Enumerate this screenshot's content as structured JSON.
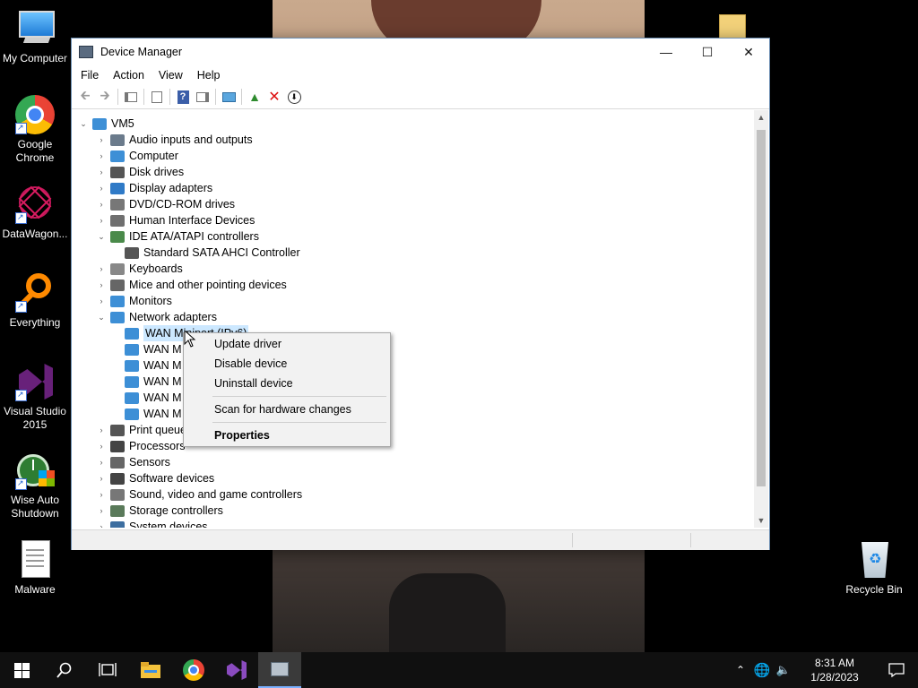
{
  "desktop": {
    "icons": [
      {
        "label": "My Computer",
        "icon": "monitor-icon"
      },
      {
        "label": "Google Chrome",
        "icon": "chrome-icon"
      },
      {
        "label": "DataWagon...",
        "icon": "datawagon-icon"
      },
      {
        "label": "Everything",
        "icon": "everything-search-icon"
      },
      {
        "label": "Visual Studio 2015",
        "icon": "visual-studio-icon"
      },
      {
        "label": "Wise Auto Shutdown",
        "icon": "wise-shutdown-icon"
      },
      {
        "label": "Malware",
        "icon": "text-file-icon"
      },
      {
        "label": "Recycle Bin",
        "icon": "recycle-bin-icon"
      }
    ]
  },
  "window": {
    "title": "Device Manager",
    "controls": {
      "minimize": "—",
      "maximize": "☐",
      "close": "✕"
    },
    "menu": [
      "File",
      "Action",
      "View",
      "Help"
    ],
    "toolbar_icons": [
      "back-arrow-icon",
      "forward-arrow-icon",
      "show-hide-tree-icon",
      "properties-icon",
      "help-icon",
      "action-pane-icon",
      "monitor-scan-icon",
      "update-driver-icon",
      "uninstall-device-icon",
      "disable-device-icon"
    ],
    "tree": {
      "root": "VM5",
      "items": [
        {
          "label": "Audio inputs and outputs",
          "expanded": false
        },
        {
          "label": "Computer",
          "expanded": false
        },
        {
          "label": "Disk drives",
          "expanded": false
        },
        {
          "label": "Display adapters",
          "expanded": false
        },
        {
          "label": "DVD/CD-ROM drives",
          "expanded": false
        },
        {
          "label": "Human Interface Devices",
          "expanded": false
        },
        {
          "label": "IDE ATA/ATAPI controllers",
          "expanded": true
        },
        {
          "label": "Standard SATA AHCI Controller",
          "child": true
        },
        {
          "label": "Keyboards",
          "expanded": false
        },
        {
          "label": "Mice and other pointing devices",
          "expanded": false
        },
        {
          "label": "Monitors",
          "expanded": false
        },
        {
          "label": "Network adapters",
          "expanded": true
        },
        {
          "label": "WAN Miniport (IPv6)",
          "child": true,
          "selected": true
        },
        {
          "label": "WAN M",
          "child": true
        },
        {
          "label": "WAN M",
          "child": true
        },
        {
          "label": "WAN M",
          "child": true
        },
        {
          "label": "WAN M",
          "child": true
        },
        {
          "label": "WAN M",
          "child": true
        },
        {
          "label": "Print queue",
          "expanded": false
        },
        {
          "label": "Processors",
          "expanded": false
        },
        {
          "label": "Sensors",
          "expanded": false
        },
        {
          "label": "Software devices",
          "expanded": false
        },
        {
          "label": "Sound, video and game controllers",
          "expanded": false
        },
        {
          "label": "Storage controllers",
          "expanded": false
        },
        {
          "label": "System devices",
          "expanded": false
        }
      ]
    }
  },
  "context_menu": {
    "items": [
      "Update driver",
      "Disable device",
      "Uninstall device",
      "Scan for hardware changes",
      "Properties"
    ]
  },
  "taskbar": {
    "apps": [
      "start-icon",
      "search-icon",
      "task-view-icon",
      "file-explorer-icon",
      "chrome-icon",
      "visual-studio-icon",
      "device-manager-icon"
    ],
    "time": "8:31 AM",
    "date": "1/28/2023"
  }
}
